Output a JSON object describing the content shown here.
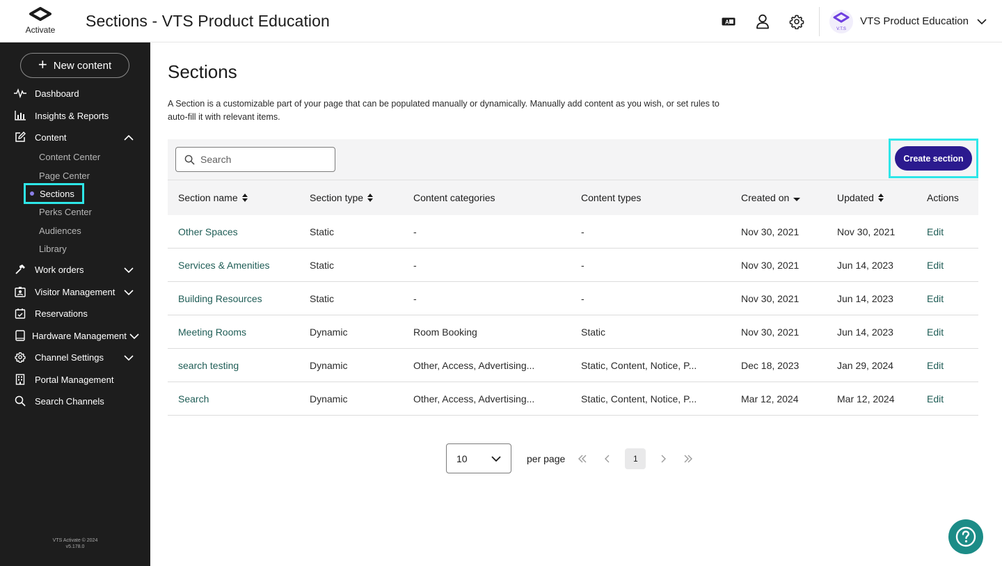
{
  "brand": {
    "logo_text": "Activate"
  },
  "header": {
    "title": "Sections - VTS Product Education",
    "org_name": "VTS Product Education",
    "org_logo_text": "V.T.S"
  },
  "sidebar": {
    "new_content_label": "New content",
    "items": [
      {
        "label": "Dashboard",
        "icon": "pulse-icon"
      },
      {
        "label": "Insights & Reports",
        "icon": "bar-chart-icon"
      },
      {
        "label": "Content",
        "icon": "edit-icon",
        "expanded": true
      },
      {
        "label": "Work orders",
        "icon": "hammer-icon"
      },
      {
        "label": "Visitor Management",
        "icon": "badge-icon"
      },
      {
        "label": "Reservations",
        "icon": "calendar-icon"
      },
      {
        "label": "Hardware Management",
        "icon": "tablet-icon"
      },
      {
        "label": "Channel Settings",
        "icon": "gear-icon"
      },
      {
        "label": "Portal Management",
        "icon": "building-icon"
      },
      {
        "label": "Search Channels",
        "icon": "search-icon"
      }
    ],
    "content_sub": [
      "Content Center",
      "Page Center",
      "Sections",
      "Perks Center",
      "Audiences",
      "Library"
    ],
    "active_sub": "Sections",
    "footer_line1": "VTS Activate © 2024",
    "footer_line2": "v5.178.0"
  },
  "main": {
    "title": "Sections",
    "description": "A Section is a customizable part of your page that can be populated manually or dynamically. Manually add content as you wish, or set rules to auto-fill it with relevant items.",
    "search_placeholder": "Search",
    "create_label": "Create section"
  },
  "table": {
    "columns": [
      "Section name",
      "Section type",
      "Content categories",
      "Content types",
      "Created on",
      "Updated",
      "Actions"
    ],
    "rows": [
      {
        "name": "Other Spaces",
        "type": "Static",
        "categories": "-",
        "content_types": "-",
        "created": "Nov 30, 2021",
        "updated": "Nov 30, 2021",
        "action": "Edit"
      },
      {
        "name": "Services & Amenities",
        "type": "Static",
        "categories": "-",
        "content_types": "-",
        "created": "Nov 30, 2021",
        "updated": "Jun 14, 2023",
        "action": "Edit"
      },
      {
        "name": "Building Resources",
        "type": "Static",
        "categories": "-",
        "content_types": "-",
        "created": "Nov 30, 2021",
        "updated": "Jun 14, 2023",
        "action": "Edit"
      },
      {
        "name": "Meeting Rooms",
        "type": "Dynamic",
        "categories": "Room Booking",
        "content_types": "Static",
        "created": "Nov 30, 2021",
        "updated": "Jun 14, 2023",
        "action": "Edit"
      },
      {
        "name": "search testing",
        "type": "Dynamic",
        "categories": "Other, Access, Advertising...",
        "content_types": "Static, Content, Notice, P...",
        "created": "Dec 18, 2023",
        "updated": "Jan 29, 2024",
        "action": "Edit"
      },
      {
        "name": "Search",
        "type": "Dynamic",
        "categories": "Other, Access, Advertising...",
        "content_types": "Static, Content, Notice, P...",
        "created": "Mar 12, 2024",
        "updated": "Mar 12, 2024",
        "action": "Edit"
      }
    ]
  },
  "pagination": {
    "per_page_value": "10",
    "per_page_label": "per page",
    "current_page": "1"
  },
  "colors": {
    "sidebar_bg": "#1d1d1d",
    "primary": "#2b1a8f",
    "link": "#1f5d56",
    "highlight": "#2ee6e8",
    "help": "#1c8c87"
  }
}
